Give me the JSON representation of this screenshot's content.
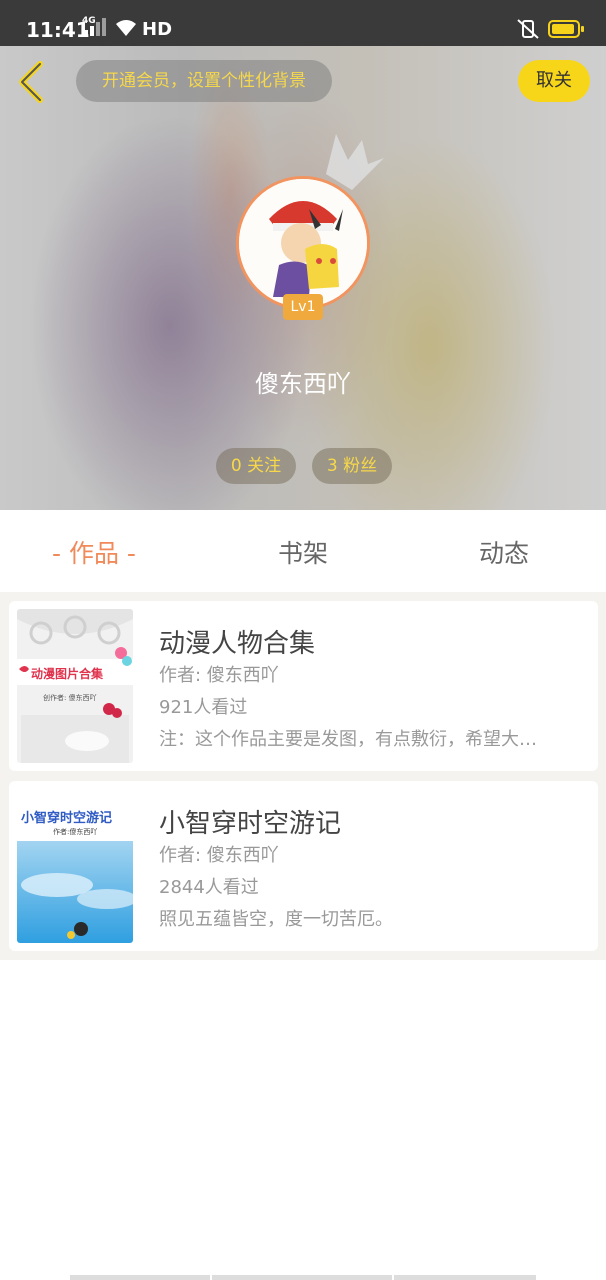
{
  "status_bar": {
    "time": "11:41",
    "network": "4G",
    "hd": "HD"
  },
  "header": {
    "vip_prompt": "开通会员，设置个性化背景",
    "unfollow_label": "取关",
    "level": "Lv1",
    "username": "傻东西吖",
    "follow_count": "0 关注",
    "fans_count": "3 粉丝"
  },
  "tabs": {
    "works": "- 作品 -",
    "shelf": "书架",
    "dynamic": "动态"
  },
  "works": [
    {
      "title": "动漫人物合集",
      "author": "作者: 傻东西吖",
      "views": "921人看过",
      "note": "注：这个作品主要是发图，有点敷衍，希望大…",
      "cover_title": "动漫图片合集",
      "cover_sub": "创作者: 傻东西吖"
    },
    {
      "title": "小智穿时空游记",
      "author": "作者: 傻东西吖",
      "views": "2844人看过",
      "note": "照见五蕴皆空，度一切苦厄。",
      "cover_title": "小智穿时空游记",
      "cover_sub": "作者:傻东西吖"
    }
  ],
  "colors": {
    "accent": "#f08a5a",
    "yellow": "#f7d61a",
    "gold_text": "#f6d84a"
  }
}
